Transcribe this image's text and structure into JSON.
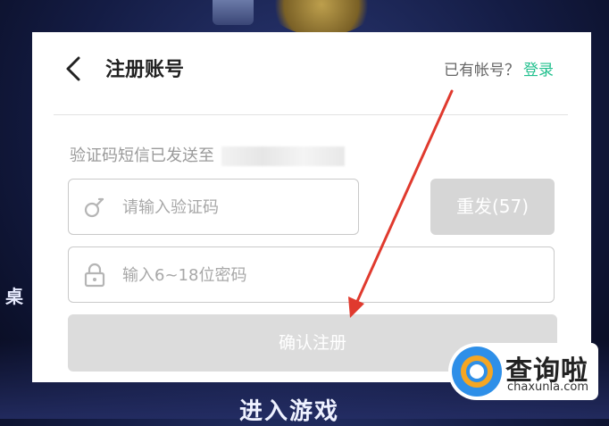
{
  "background": {
    "side_text": "桌",
    "bottom_text": "进入游戏"
  },
  "dialog": {
    "title": "注册账号",
    "login_hint": "已有帐号？",
    "login_link": "登录",
    "sms_notice": "验证码短信已发送至",
    "code_input": {
      "placeholder": "请输入验证码",
      "value": ""
    },
    "resend_button": "重发(57)",
    "password_input": {
      "placeholder": "输入6~18位密码",
      "value": ""
    },
    "confirm_button": "确认注册"
  },
  "watermark": {
    "name": "查询啦",
    "domain": "chaxunla.com"
  },
  "colors": {
    "accent": "#22c08e",
    "annotation_arrow": "#e03a2e",
    "disabled_button": "#d6d6d6"
  }
}
